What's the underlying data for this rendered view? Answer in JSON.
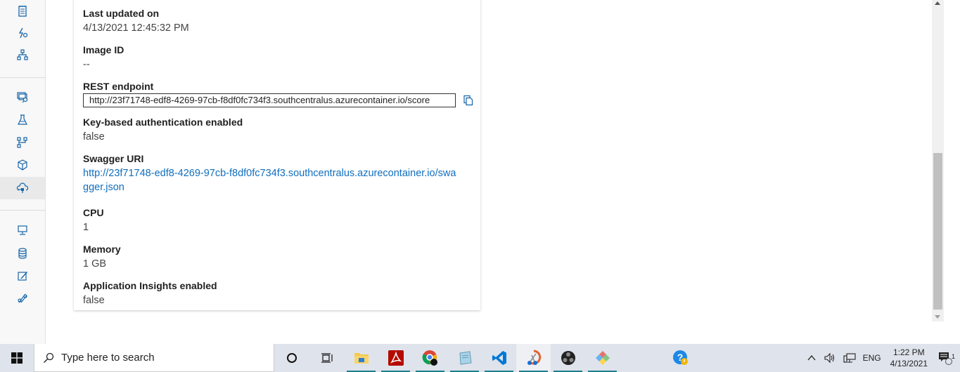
{
  "sidebar": {
    "items": [
      {
        "icon": "notebook-icon",
        "label": "Notebooks"
      },
      {
        "icon": "automl-icon",
        "label": "Automated ML"
      },
      {
        "icon": "designer-icon",
        "label": "Designer"
      },
      {
        "icon": "datasets-icon",
        "label": "Datasets"
      },
      {
        "icon": "experiments-icon",
        "label": "Experiments"
      },
      {
        "icon": "pipelines-icon",
        "label": "Pipelines"
      },
      {
        "icon": "models-icon",
        "label": "Models"
      },
      {
        "icon": "endpoints-icon",
        "label": "Endpoints",
        "active": true
      },
      {
        "icon": "compute-icon",
        "label": "Compute"
      },
      {
        "icon": "datastores-icon",
        "label": "Datastores"
      },
      {
        "icon": "data-labeling-icon",
        "label": "Data Labeling"
      },
      {
        "icon": "linked-services-icon",
        "label": "Linked services"
      }
    ]
  },
  "details": {
    "last_updated": {
      "label": "Last updated on",
      "value": "4/13/2021 12:45:32 PM"
    },
    "image_id": {
      "label": "Image ID",
      "value": "--"
    },
    "rest_endpoint": {
      "label": "REST endpoint",
      "value": "http://23f71748-edf8-4269-97cb-f8df0fc734f3.southcentralus.azurecontainer.io/score"
    },
    "key_auth": {
      "label": "Key-based authentication enabled",
      "value": "false"
    },
    "swagger_uri": {
      "label": "Swagger URI",
      "value": "http://23f71748-edf8-4269-97cb-f8df0fc734f3.southcentralus.azurecontainer.io/swagger.json"
    },
    "cpu": {
      "label": "CPU",
      "value": "1"
    },
    "memory": {
      "label": "Memory",
      "value": "1 GB"
    },
    "app_insights": {
      "label": "Application Insights enabled",
      "value": "false"
    }
  },
  "taskbar": {
    "search_placeholder": "Type here to search",
    "apps": [
      {
        "icon": "cortana-icon",
        "name": "Cortana"
      },
      {
        "icon": "task-view-icon",
        "name": "Task View"
      },
      {
        "icon": "file-explorer-icon",
        "name": "File Explorer",
        "running": true
      },
      {
        "icon": "acrobat-icon",
        "name": "Adobe Acrobat",
        "running": true
      },
      {
        "icon": "chrome-icon",
        "name": "Google Chrome",
        "running": true
      },
      {
        "icon": "notepad-icon",
        "name": "Notepad",
        "running": true
      },
      {
        "icon": "vscode-icon",
        "name": "Visual Studio Code",
        "running": true
      },
      {
        "icon": "snip-sketch-icon",
        "name": "Snip & Sketch",
        "running": true,
        "active": true
      },
      {
        "icon": "obs-icon",
        "name": "OBS Studio",
        "running": true
      },
      {
        "icon": "app-icon",
        "name": "App",
        "running": true
      },
      {
        "icon": "help-icon",
        "name": "Get Help"
      }
    ],
    "tray": {
      "language": "ENG",
      "time": "1:22 PM",
      "date": "4/13/2021",
      "notifications_count": "1"
    }
  }
}
